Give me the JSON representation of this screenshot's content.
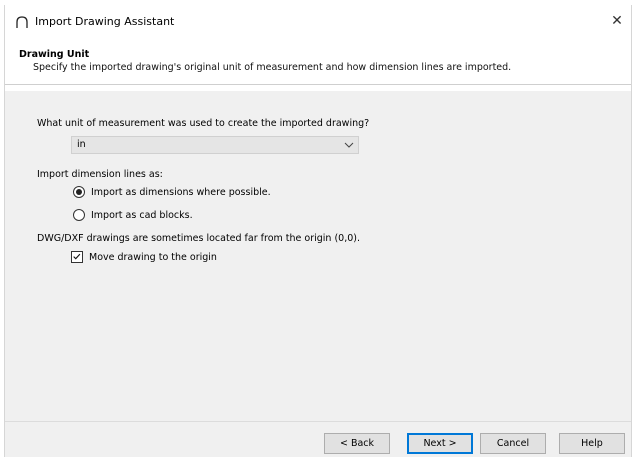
{
  "window": {
    "title": "Import Drawing Assistant",
    "close_glyph": "✕"
  },
  "header": {
    "title": "Drawing Unit",
    "description": "Specify the imported drawing's original unit of measurement and how dimension lines are imported."
  },
  "unit": {
    "question": "What unit of measurement was used to create the imported drawing?",
    "selected": "in"
  },
  "dimensions": {
    "label": "Import dimension lines as:",
    "options": [
      {
        "label": "Import as dimensions where possible.",
        "checked": true
      },
      {
        "label": "Import as cad blocks.",
        "checked": false
      }
    ]
  },
  "origin": {
    "note": "DWG/DXF drawings are sometimes located far from the origin (0,0).",
    "checkbox_label": "Move drawing to the origin",
    "checked": true
  },
  "buttons": {
    "back": "< Back",
    "next": "Next >",
    "cancel": "Cancel",
    "help": "Help"
  },
  "colors": {
    "accent": "#0078d7",
    "panel": "#f0f0f0"
  }
}
